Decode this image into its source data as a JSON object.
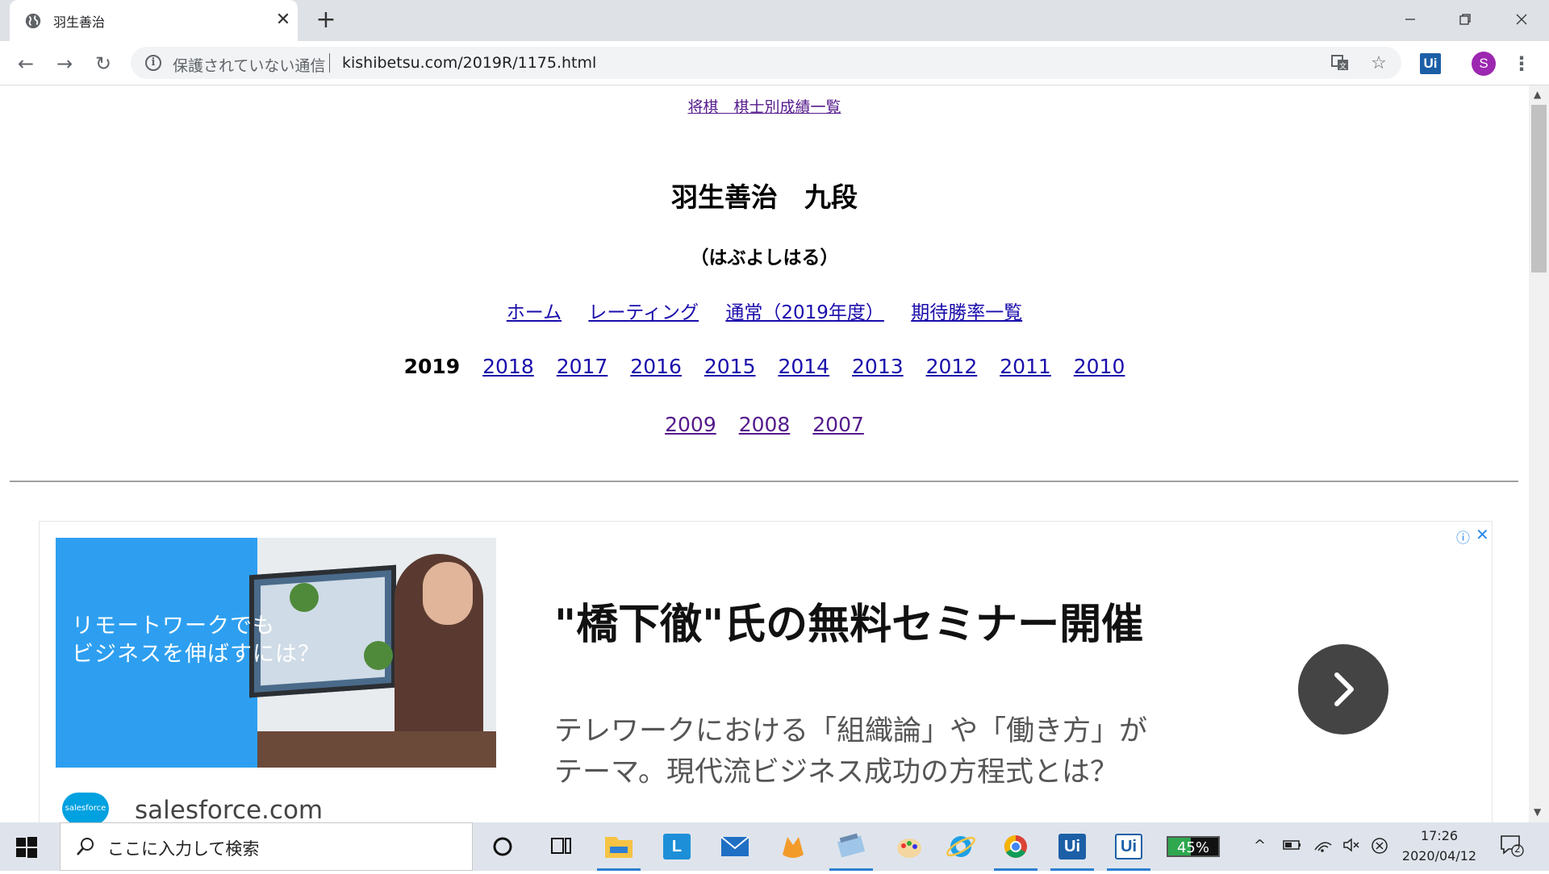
{
  "browser": {
    "tab_title": "羽生善治",
    "security_label": "保護されていない通信",
    "url": "kishibetsu.com/2019R/1175.html",
    "extension_label": "Ui",
    "profile_initial": "S"
  },
  "page": {
    "site_link": "将棋　棋士別成績一覧",
    "player_name": "羽生善治　九段",
    "player_reading": "（はぶよしはる）",
    "nav_links": [
      "ホーム",
      "レーティング",
      "通常（2019年度）",
      "期待勝率一覧"
    ],
    "current_year": "2019",
    "years_row1": [
      "2018",
      "2017",
      "2016",
      "2015",
      "2014",
      "2013",
      "2012",
      "2011",
      "2010"
    ],
    "years_row2": [
      "2009",
      "2008",
      "2007"
    ]
  },
  "ad": {
    "image_text_line1": "リモートワークでも",
    "image_text_line2": "ビジネスを伸ばすには？",
    "headline": "\"橋下徹\"氏の無料セミナー開催",
    "body_line1": "テレワークにおける「組織論」や「働き方」が",
    "body_line2": "テーマ。現代流ビジネス成功の方程式とは？",
    "logo_text": "salesforce",
    "domain": "salesforce.com"
  },
  "taskbar": {
    "search_placeholder": "ここに入力して検索",
    "battery_percent": "45%",
    "battery_level": 0.45,
    "time": "17:26",
    "date": "2020/04/12",
    "notification_count": "2",
    "app_labels": [
      "L",
      "Ui",
      "Ui"
    ]
  },
  "colors": {
    "link": "#1a0dab",
    "visited_link": "#551a8b",
    "ad_blue": "#2e9ff0",
    "taskbar": "#dfe4ec"
  }
}
